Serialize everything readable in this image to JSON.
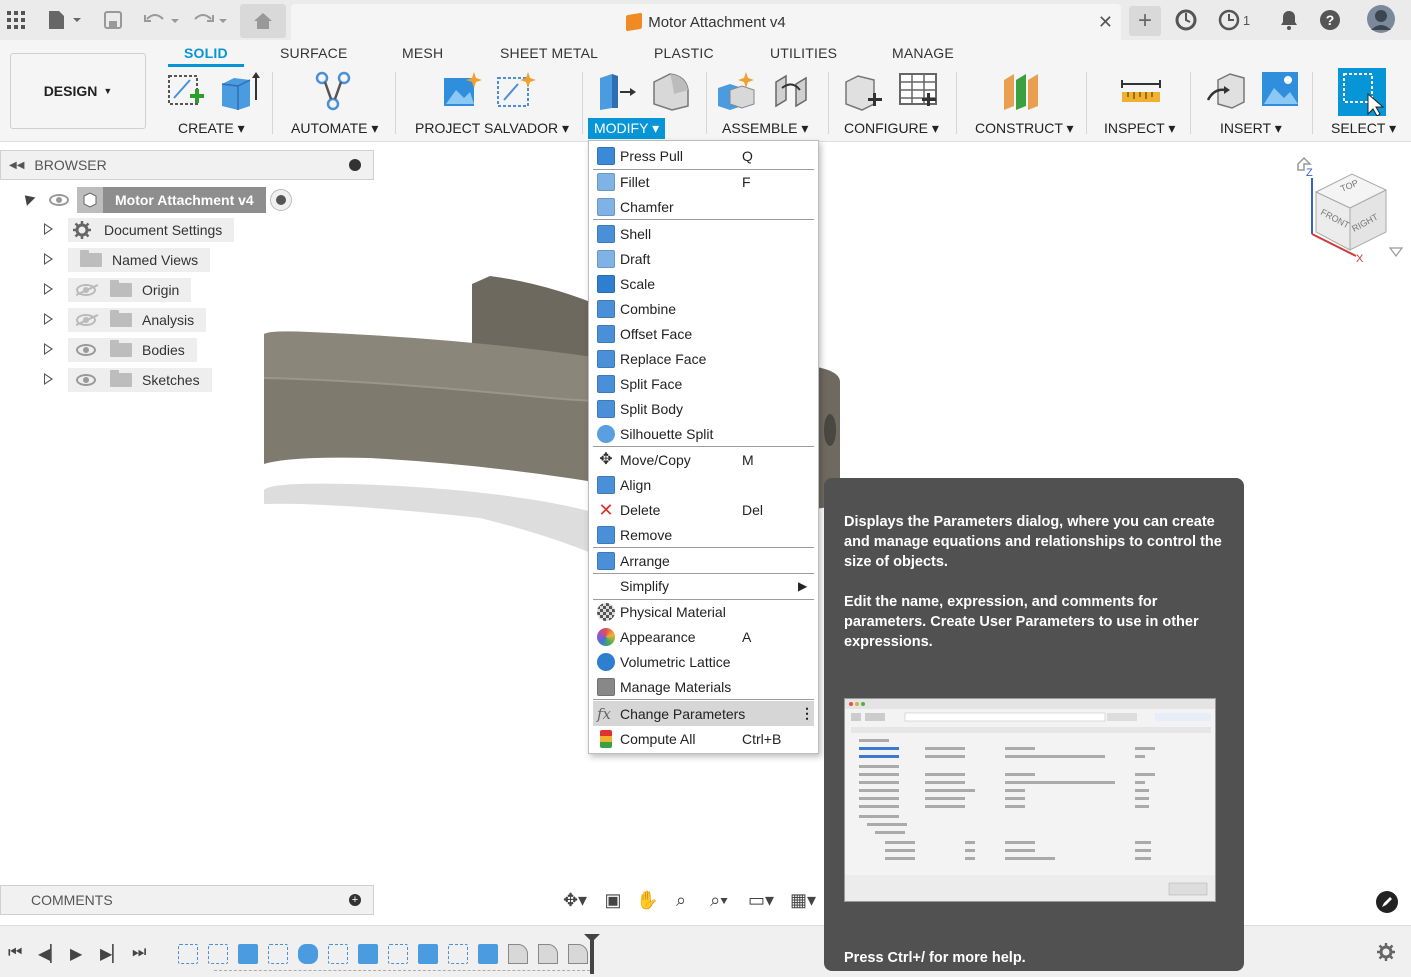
{
  "titlebar": {
    "document_title": "Motor Attachment v4",
    "notifications_count": "1"
  },
  "ribbon": {
    "workspace": "DESIGN",
    "tabs": [
      "SOLID",
      "SURFACE",
      "MESH",
      "SHEET METAL",
      "PLASTIC",
      "UTILITIES",
      "MANAGE"
    ],
    "active_tab": "SOLID",
    "groups": [
      "CREATE",
      "AUTOMATE",
      "PROJECT SALVADOR",
      "MODIFY",
      "ASSEMBLE",
      "CONFIGURE",
      "CONSTRUCT",
      "INSPECT",
      "INSERT",
      "SELECT"
    ],
    "active_group": "MODIFY"
  },
  "browser": {
    "title": "BROWSER",
    "root": "Motor Attachment v4",
    "items": [
      {
        "label": "Document Settings",
        "icon": "gear-icon",
        "visibility": "none"
      },
      {
        "label": "Named Views",
        "icon": "folder-icon",
        "visibility": "none"
      },
      {
        "label": "Origin",
        "icon": "folder-icon",
        "visibility": "hidden"
      },
      {
        "label": "Analysis",
        "icon": "folder-icon",
        "visibility": "hidden"
      },
      {
        "label": "Bodies",
        "icon": "folder-icon",
        "visibility": "visible"
      },
      {
        "label": "Sketches",
        "icon": "folder-icon",
        "visibility": "visible"
      }
    ]
  },
  "comments": {
    "title": "COMMENTS"
  },
  "viewcube": {
    "top": "TOP",
    "front": "FRONT",
    "right": "RIGHT",
    "z_axis": "Z",
    "x_axis": "X"
  },
  "menu": {
    "items": [
      {
        "label": "Press Pull",
        "shortcut": "Q",
        "icon": "press-pull-icon",
        "color": "#3b8ad8"
      },
      {
        "label": "Fillet",
        "shortcut": "F",
        "icon": "fillet-icon",
        "color": "#7fb2e5"
      },
      {
        "label": "Chamfer",
        "shortcut": "",
        "icon": "chamfer-icon",
        "color": "#7fb2e5"
      },
      {
        "label": "Shell",
        "shortcut": "",
        "icon": "shell-icon",
        "color": "#4a90d9"
      },
      {
        "label": "Draft",
        "shortcut": "",
        "icon": "draft-icon",
        "color": "#7fb2e5"
      },
      {
        "label": "Scale",
        "shortcut": "",
        "icon": "scale-icon",
        "color": "#2f7fd0"
      },
      {
        "label": "Combine",
        "shortcut": "",
        "icon": "combine-icon",
        "color": "#4a90d9"
      },
      {
        "label": "Offset Face",
        "shortcut": "",
        "icon": "offset-face-icon",
        "color": "#4a90d9"
      },
      {
        "label": "Replace Face",
        "shortcut": "",
        "icon": "replace-face-icon",
        "color": "#4a90d9"
      },
      {
        "label": "Split Face",
        "shortcut": "",
        "icon": "split-face-icon",
        "color": "#4a90d9"
      },
      {
        "label": "Split Body",
        "shortcut": "",
        "icon": "split-body-icon",
        "color": "#4a90d9"
      },
      {
        "label": "Silhouette Split",
        "shortcut": "",
        "icon": "silhouette-split-icon",
        "color": "#5aa0e0"
      },
      {
        "label": "Move/Copy",
        "shortcut": "M",
        "icon": "move-icon",
        "color": "#333333"
      },
      {
        "label": "Align",
        "shortcut": "",
        "icon": "align-icon",
        "color": "#4a90d9"
      },
      {
        "label": "Delete",
        "shortcut": "Del",
        "icon": "delete-icon",
        "color": "#e03030"
      },
      {
        "label": "Remove",
        "shortcut": "",
        "icon": "remove-icon",
        "color": "#4a90d9"
      },
      {
        "label": "Arrange",
        "shortcut": "",
        "icon": "arrange-icon",
        "color": "#4a90d9"
      },
      {
        "label": "Simplify",
        "shortcut": "",
        "icon": "",
        "color": "#ffffff"
      },
      {
        "label": "Physical Material",
        "shortcut": "",
        "icon": "physical-material-icon",
        "color": "#555555"
      },
      {
        "label": "Appearance",
        "shortcut": "A",
        "icon": "appearance-icon",
        "color": "#e05050"
      },
      {
        "label": "Volumetric Lattice",
        "shortcut": "",
        "icon": "volumetric-lattice-icon",
        "color": "#2f7fd0"
      },
      {
        "label": "Manage Materials",
        "shortcut": "",
        "icon": "manage-materials-icon",
        "color": "#888888"
      },
      {
        "label": "Change Parameters",
        "shortcut": "",
        "icon": "fx-icon",
        "color": "#d6d6d6"
      },
      {
        "label": "Compute All",
        "shortcut": "Ctrl+B",
        "icon": "compute-all-icon",
        "color": "#3aa040"
      }
    ]
  },
  "tooltip": {
    "para1": "Displays the Parameters dialog, where you can create and manage equations and relationships to control the size of objects.",
    "para2": "Edit the name, expression, and comments for parameters. Create User Parameters to use in other expressions.",
    "footer": "Press Ctrl+/ for more help."
  },
  "colors": {
    "accent": "#0696d7",
    "model": "#7a766c",
    "tooltip_bg": "#515151"
  }
}
